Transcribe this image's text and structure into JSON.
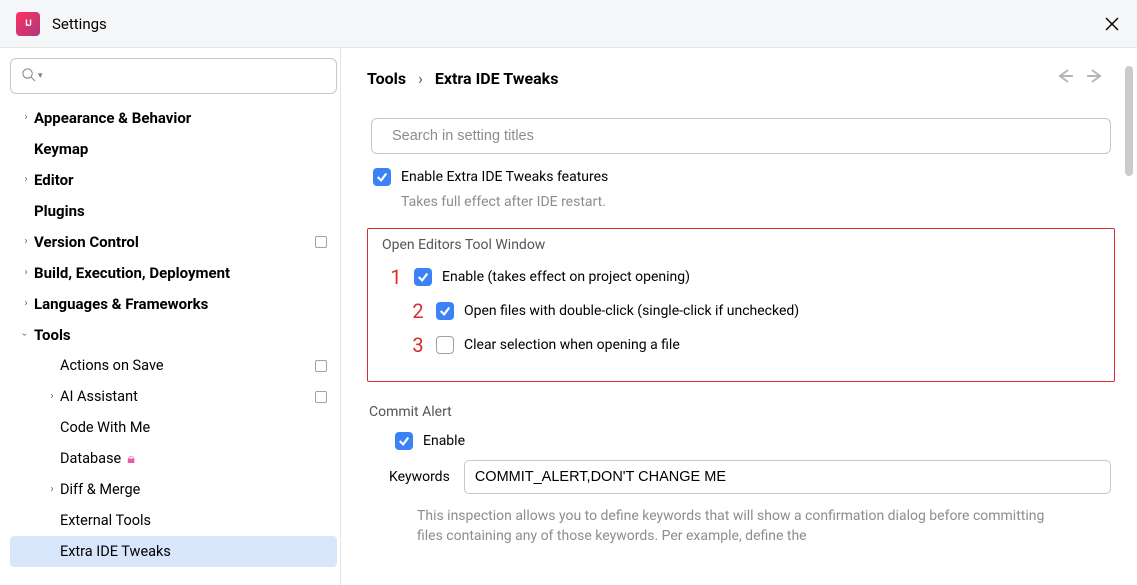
{
  "window": {
    "title": "Settings"
  },
  "sidebar": {
    "items": [
      {
        "label": "Appearance & Behavior",
        "arrow": "right",
        "top": true
      },
      {
        "label": "Keymap",
        "arrow": "",
        "top": true
      },
      {
        "label": "Editor",
        "arrow": "right",
        "top": true
      },
      {
        "label": "Plugins",
        "arrow": "",
        "top": true
      },
      {
        "label": "Version Control",
        "arrow": "right",
        "top": true,
        "badge": true
      },
      {
        "label": "Build, Execution, Deployment",
        "arrow": "right",
        "top": true
      },
      {
        "label": "Languages & Frameworks",
        "arrow": "right",
        "top": true
      },
      {
        "label": "Tools",
        "arrow": "down",
        "top": true
      }
    ],
    "tools_children": [
      {
        "label": "Actions on Save",
        "arrow": "",
        "badge": true
      },
      {
        "label": "AI Assistant",
        "arrow": "right",
        "badge": true
      },
      {
        "label": "Code With Me"
      },
      {
        "label": "Database",
        "lock": true
      },
      {
        "label": "Diff & Merge",
        "arrow": "right"
      },
      {
        "label": "External Tools"
      },
      {
        "label": "Extra IDE Tweaks",
        "selected": true
      }
    ]
  },
  "breadcrumb": {
    "a": "Tools",
    "sep": "›",
    "b": "Extra IDE Tweaks"
  },
  "content_search": {
    "placeholder": "Search in setting titles"
  },
  "enable_feature": {
    "label": "Enable Extra IDE Tweaks features",
    "hint": "Takes full effect after IDE restart.",
    "checked": true
  },
  "open_editors": {
    "title": "Open Editors Tool Window",
    "opt1": {
      "ann": "1",
      "label": "Enable (takes effect on project opening)",
      "checked": true
    },
    "opt2": {
      "ann": "2",
      "label": "Open files with double-click (single-click if unchecked)",
      "checked": true
    },
    "opt3": {
      "ann": "3",
      "label": "Clear selection when opening a file",
      "checked": false
    }
  },
  "commit_alert": {
    "title": "Commit Alert",
    "enable_label": "Enable",
    "enable_checked": true,
    "keywords_label": "Keywords",
    "keywords_value": "COMMIT_ALERT,DON'T CHANGE ME",
    "desc": "This inspection allows you to define keywords that will show a confirmation dialog before committing files containing any of those keywords. Per example, define the"
  }
}
